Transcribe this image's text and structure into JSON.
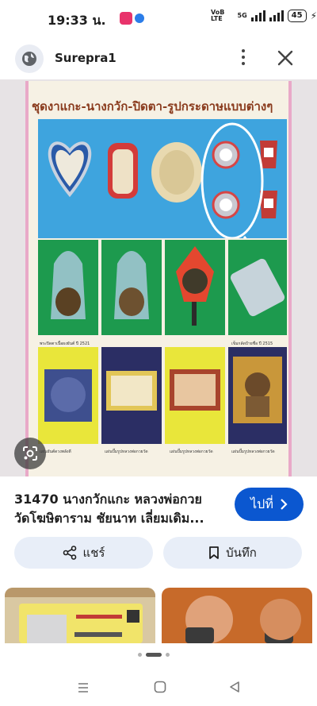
{
  "status": {
    "time": "19:33 น.",
    "network_label": "VoB LTE",
    "network_type": "5G",
    "battery": "45"
  },
  "site": {
    "name": "Surepra1"
  },
  "poster": {
    "title": "ชุดงาแกะ-นางกวัก-ปิดตา-รูปกระดาษแบบต่างๆ",
    "labels": {
      "green1": "พระปิดตาเนื้อผงยันต์ ปี 2521",
      "green2": "เลี่ยมพร้อมใช้",
      "silver": "เข็มกลัดป้ายชื่อ ปี 2515",
      "bottom2": "แผ่นปั๊มรูปหลวงพ่อกวยวัด",
      "bottom3": "แผ่นปั๊มรูปหลวงพ่อกวยวัด",
      "bottom4": "แผ่นปั๊มรูปหลวงพ่อกวยวัด",
      "bottom1": "แผ่นยันต์ดวงพลังดี"
    }
  },
  "result": {
    "title_line1": "31470 นางกวักแกะ หลวงพ่อกวย",
    "title_line2": "วัดโฆษิตาราม ชัยนาท เลี่ยมเดิม...",
    "goto_label": "ไปที่"
  },
  "actions": {
    "share_label": "แชร์",
    "save_label": "บันทึก"
  },
  "icons": {
    "globe": "globe-icon",
    "more": "more-vert-icon",
    "close": "close-icon",
    "lens": "google-lens-icon",
    "share": "share-icon",
    "bookmark": "bookmark-icon",
    "chevron": "chevron-right-icon",
    "recents": "recents-icon",
    "home": "home-icon",
    "back": "back-icon"
  },
  "colors": {
    "primary": "#0b57d0",
    "action_bg": "#e8eef8"
  }
}
